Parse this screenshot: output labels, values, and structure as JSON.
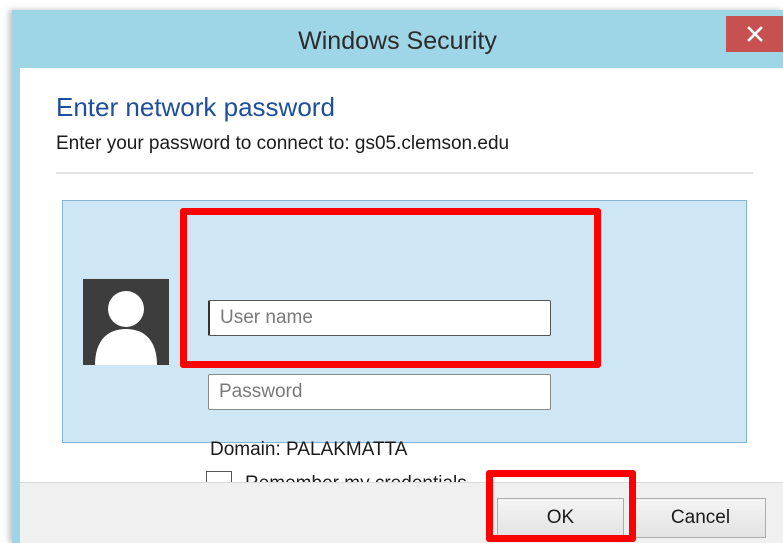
{
  "window": {
    "title": "Windows Security",
    "close_icon": "close-icon",
    "titlebar_color": "#9fd6e7",
    "close_color": "#c75050"
  },
  "dialog": {
    "heading": "Enter network password",
    "subtext": "Enter your password to connect to: gs05.clemson.edu",
    "heading_color": "#1e4e9c"
  },
  "credentials": {
    "avatar_icon": "user-avatar-icon",
    "username": {
      "placeholder": "User name",
      "value": ""
    },
    "password": {
      "placeholder": "Password",
      "value": ""
    },
    "domain": "Domain: PALAKMATTA",
    "remember_label": "Remember my credentials",
    "remember_checked": false,
    "panel_color": "#cfe6f5"
  },
  "buttons": {
    "ok": "OK",
    "cancel": "Cancel"
  },
  "annotations": {
    "highlight_color": "#ff0000"
  }
}
